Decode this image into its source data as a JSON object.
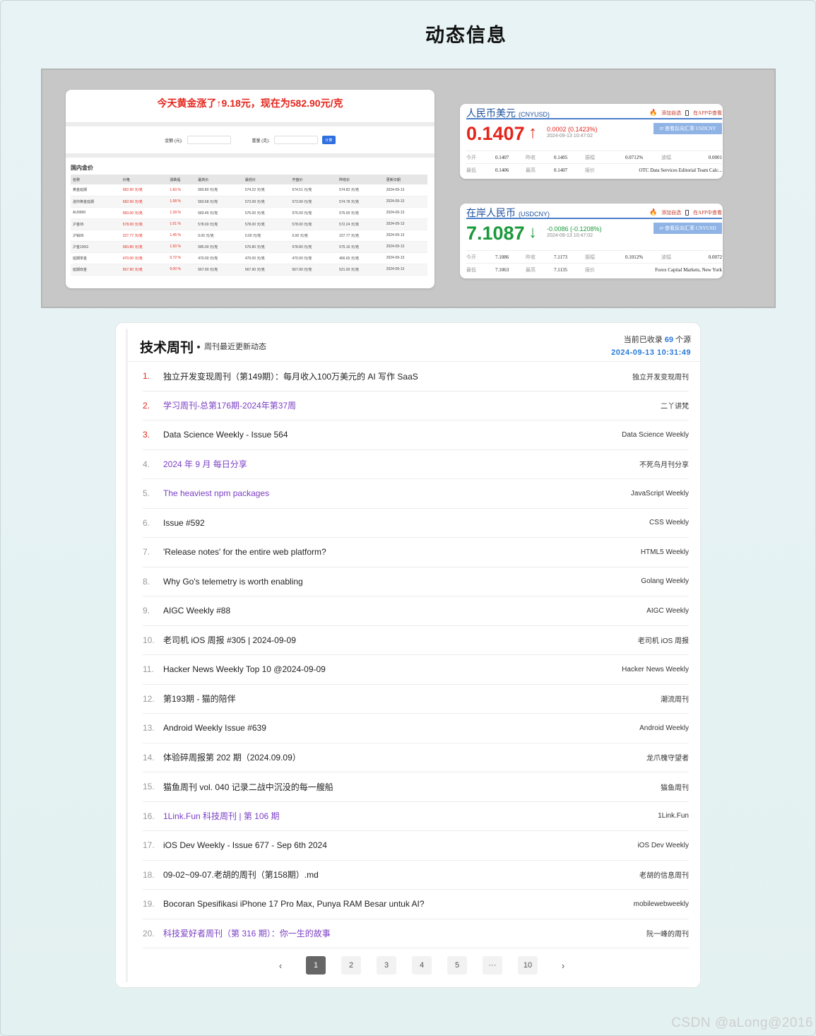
{
  "page": {
    "title": "动态信息"
  },
  "gold": {
    "headline": "今天黄金涨了↑9.18元，现在为582.90元/克",
    "form": {
      "amount_label": "金额 (元):",
      "weight_label": "重量 (克):",
      "calc_label": "计算"
    },
    "section_title": "国内金价",
    "columns": [
      "名称",
      "价格",
      "涨跌幅",
      "最高价",
      "最低价",
      "开盘价",
      "昨收价",
      "更新日期"
    ],
    "rows": [
      [
        "黄金延期",
        "582.90 元/克",
        "1.60 %",
        "583.80 元/克",
        "574.22 元/克",
        "574.51 元/克",
        "574.82 元/克",
        "2024-09-13"
      ],
      [
        "迷你黄金延期",
        "582.99 元/克",
        "1.58 %",
        "583.68 元/克",
        "573.99 元/克",
        "573.99 元/克",
        "574.78 元/克",
        "2024-09-13"
      ],
      [
        "AU9999",
        "583.00 元/克",
        "1.39 %",
        "583.45 元/克",
        "575.00 元/克",
        "575.00 元/克",
        "575.00 元/克",
        "2024-09-13"
      ],
      [
        "沪金95",
        "578.00 元/克",
        "1.01 %",
        "578.00 元/克",
        "578.00 元/克",
        "578.00 元/克",
        "572.24 元/克",
        "2024-09-13"
      ],
      [
        "沪铂95",
        "227.77 元/克",
        "1.45 %",
        "0.00 元/克",
        "0.00 元/克",
        "0.00 元/克",
        "227.77 元/克",
        "2024-09-13"
      ],
      [
        "沪金100G",
        "583.80 元/克",
        "1.50 %",
        "585.00 元/克",
        "576.80 元/克",
        "578.80 元/克",
        "575.16 元/克",
        "2024-09-13"
      ],
      [
        "延期单金",
        "470.00 元/克",
        "0.72 %",
        "470.00 元/克",
        "470.00 元/克",
        "470.00 元/克",
        "466.65 元/克",
        "2024-09-13"
      ],
      [
        "延期双金",
        "567.90 元/克",
        "9.00 %",
        "567.90 元/克",
        "567.90 元/克",
        "567.90 元/克",
        "521.00 元/克",
        "2024-09-13"
      ]
    ]
  },
  "fx": [
    {
      "name": "人民币美元",
      "code": "(CNYUSD)",
      "price": "0.1407",
      "direction": "up",
      "arrow": "↑",
      "change": "0.0002 (0.1423%)",
      "time": "2024-09-13 10:47:02",
      "add_label": "添加自选",
      "app_label": "在APP中查看",
      "reverse_label": "⇄ 查看反向汇率 USDCNY",
      "stats_row1": {
        "l1": "今开",
        "v1": "0.1407",
        "l2": "昨收",
        "v2": "0.1405",
        "l3": "振幅",
        "v3": "0.0712%",
        "l4": "波幅",
        "v4": "0.0001"
      },
      "stats_row2": {
        "l1": "最低",
        "v1": "0.1406",
        "l2": "最高",
        "v2": "0.1407",
        "l3": "报价",
        "v3": "OTC Data Services Editorial Team Calc..."
      },
      "colors": {
        "price": "#e5251c"
      }
    },
    {
      "name": "在岸人民币",
      "code": "(USDCNY)",
      "price": "7.1087",
      "direction": "down",
      "arrow": "↓",
      "change": "-0.0086 (-0.1208%)",
      "time": "2024-09-13 10:47:02",
      "add_label": "添加自选",
      "app_label": "在APP中查看",
      "reverse_label": "⇄ 查看反向汇率 CNYUSD",
      "stats_row1": {
        "l1": "今开",
        "v1": "7.1086",
        "l2": "昨收",
        "v2": "7.1173",
        "l3": "振幅",
        "v3": "0.1012%",
        "l4": "波幅",
        "v4": "0.0072"
      },
      "stats_row2": {
        "l1": "最低",
        "v1": "7.1063",
        "l2": "最高",
        "v2": "7.1135",
        "l3": "报价",
        "v3": "Forex Capital Markets, New York"
      },
      "colors": {
        "price": "#1a9a3a"
      }
    }
  ],
  "weekly": {
    "title": "技术周刊",
    "subtitle": "周刊最近更新动态",
    "stats_prefix": "当前已收录",
    "stats_count": "69",
    "stats_suffix": "个源",
    "updated": "2024-09-13 10:31:49",
    "items": [
      {
        "idx": "1.",
        "title": "独立开发变现周刊（第149期）：每月收入100万美元的 AI 写作 SaaS",
        "source": "独立开发变现周刊",
        "visited": false
      },
      {
        "idx": "2.",
        "title": "学习周刊-总第176期-2024年第37周",
        "source": "二丫讲梵",
        "visited": true
      },
      {
        "idx": "3.",
        "title": "Data Science Weekly - Issue 564",
        "source": "Data Science Weekly",
        "visited": false
      },
      {
        "idx": "4.",
        "title": "2024 年 9 月 每日分享",
        "source": "不死鸟月刊分享",
        "visited": true
      },
      {
        "idx": "5.",
        "title": "The heaviest npm packages",
        "source": "JavaScript Weekly",
        "visited": true
      },
      {
        "idx": "6.",
        "title": "Issue #592",
        "source": "CSS Weekly",
        "visited": false
      },
      {
        "idx": "7.",
        "title": "'Release notes' for the entire web platform?",
        "source": "HTML5 Weekly",
        "visited": false
      },
      {
        "idx": "8.",
        "title": "Why Go's telemetry is worth enabling",
        "source": "Golang Weekly",
        "visited": false
      },
      {
        "idx": "9.",
        "title": "AIGC Weekly #88",
        "source": "AIGC Weekly",
        "visited": false
      },
      {
        "idx": "10.",
        "title": "老司机 iOS 周报 #305 | 2024-09-09",
        "source": "老司机 iOS 周报",
        "visited": false
      },
      {
        "idx": "11.",
        "title": "Hacker News Weekly Top 10 @2024-09-09",
        "source": "Hacker News Weekly",
        "visited": false
      },
      {
        "idx": "12.",
        "title": "第193期 - 猫的陪伴",
        "source": "潮流周刊",
        "visited": false
      },
      {
        "idx": "13.",
        "title": "Android Weekly Issue #639",
        "source": "Android Weekly",
        "visited": false
      },
      {
        "idx": "14.",
        "title": "体验碎周报第 202 期（2024.09.09）",
        "source": "龙爪槐守望者",
        "visited": false
      },
      {
        "idx": "15.",
        "title": "猫鱼周刊 vol. 040 记录二战中沉没的每一艘船",
        "source": "猫鱼周刊",
        "visited": false
      },
      {
        "idx": "16.",
        "title": "1Link.Fun 科技周刊 | 第 106 期",
        "source": "1Link.Fun",
        "visited": true
      },
      {
        "idx": "17.",
        "title": "iOS Dev Weekly - Issue 677 - Sep 6th 2024",
        "source": "iOS Dev Weekly",
        "visited": false
      },
      {
        "idx": "18.",
        "title": "09-02~09-07.老胡的周刊（第158期）.md",
        "source": "老胡的信息周刊",
        "visited": false
      },
      {
        "idx": "19.",
        "title": "Bocoran Spesifikasi iPhone 17 Pro Max, Punya RAM Besar untuk AI?",
        "source": "mobilewebweekly",
        "visited": false
      },
      {
        "idx": "20.",
        "title": "科技爱好者周刊（第 316 期）：你一生的故事",
        "source": "阮一峰的周刊",
        "visited": true
      }
    ],
    "pager": {
      "prev": "‹",
      "pages": [
        "1",
        "2",
        "3",
        "4",
        "5",
        "···",
        "10"
      ],
      "active": "1",
      "next": "›"
    }
  },
  "watermark": "CSDN @aLong@2016"
}
